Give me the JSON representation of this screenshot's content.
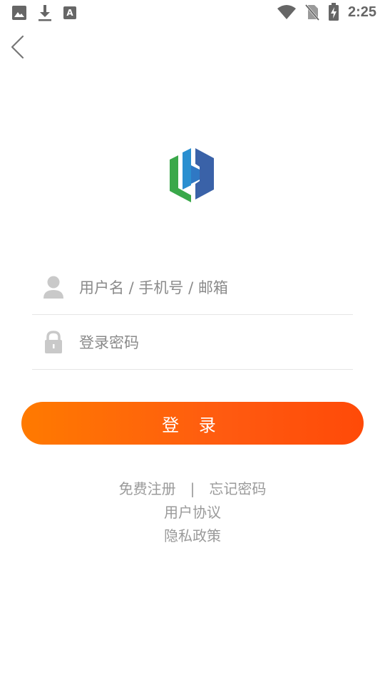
{
  "status_bar": {
    "time": "2:25",
    "left_icons": [
      "image-icon",
      "download-icon",
      "text-a-icon"
    ],
    "right_icons": [
      "wifi-icon",
      "no-sim-icon",
      "battery-charging-icon"
    ]
  },
  "header": {
    "back_icon": "chevron-left-icon"
  },
  "form": {
    "username_placeholder": "用户名 / 手机号 / 邮箱",
    "password_placeholder": "登录密码",
    "username_value": "",
    "password_value": ""
  },
  "login_button": {
    "label": "登 录",
    "gradient_start": "#ff7a00",
    "gradient_end": "#ff4a08"
  },
  "links": {
    "register": "免费注册",
    "separator": "|",
    "forgot_password": "忘记密码",
    "user_agreement": "用户协议",
    "privacy_policy": "隐私政策"
  },
  "colors": {
    "logo_green": "#3aa84a",
    "logo_blue": "#2a8fd0",
    "logo_dark_blue": "#3a62a8",
    "link_gray": "#9a9a9a"
  }
}
